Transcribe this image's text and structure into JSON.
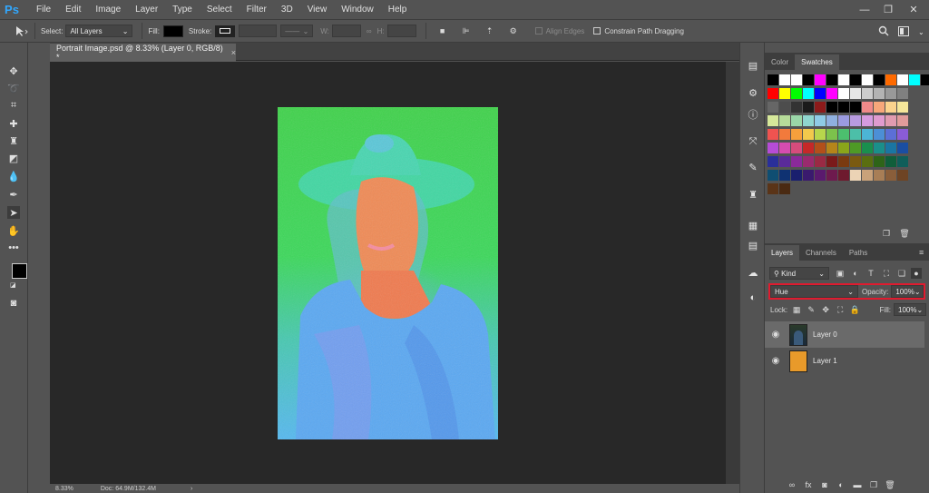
{
  "app": {
    "logo": "Ps"
  },
  "menu": [
    "File",
    "Edit",
    "Image",
    "Layer",
    "Type",
    "Select",
    "Filter",
    "3D",
    "View",
    "Window",
    "Help"
  ],
  "window_controls": {
    "minimize": "—",
    "restore": "❐",
    "close": "✕"
  },
  "options_bar": {
    "select_label": "Select:",
    "select_value": "All Layers",
    "fill_label": "Fill:",
    "stroke_label": "Stroke:",
    "w_label": "W:",
    "h_label": "H:",
    "align_edges": "Align Edges",
    "constrain": "Constrain Path Dragging"
  },
  "document": {
    "tab_title": "Portrait Image.psd @ 8.33% (Layer 0, RGB/8) *",
    "zoom": "8.33%",
    "doc_size": "Doc: 64.9M/132.4M"
  },
  "color_panel": {
    "tabs": [
      "Color",
      "Swatches"
    ],
    "active_tab": "Swatches"
  },
  "layers_panel": {
    "tabs": [
      "Layers",
      "Channels",
      "Paths"
    ],
    "kind_label": "Kind",
    "blend_mode": "Hue",
    "opacity_label": "Opacity:",
    "opacity_value": "100%",
    "lock_label": "Lock:",
    "fill_label": "Fill:",
    "fill_value": "100%",
    "layers": [
      {
        "name": "Layer 0"
      },
      {
        "name": "Layer 1"
      }
    ]
  },
  "swatches": [
    [
      "#000000",
      "#ffffff",
      "#ffffff",
      "#000000",
      "#ff00ff",
      "#000000",
      "#ffffff",
      "#000000",
      "#ffffff",
      "#000000",
      "#ff6a00",
      "#ffffff",
      "#00ffff",
      "#000000"
    ],
    [
      "#ff0000",
      "#ffff00",
      "#00ff00",
      "#00ffff",
      "#0000ff",
      "#ff00ff",
      "#ffffff",
      "#e6e6e6",
      "#cccccc",
      "#b3b3b3",
      "#999999",
      "#808080"
    ],
    [
      "#666666",
      "#4d4d4d",
      "#333333",
      "#1a1a1a",
      "#8c1a1a",
      "#000000",
      "#000000",
      "#000000",
      "#f08a8a",
      "#f7a77a",
      "#fbd38d",
      "#f5e69a"
    ],
    [
      "#d6e89a",
      "#b7dc9a",
      "#9ad6a8",
      "#8fd6cf",
      "#8fcbe6",
      "#8fb0e0",
      "#9b9be0",
      "#b89be0",
      "#d69be0",
      "#e09bcf",
      "#e09bb0",
      "#e09b9b"
    ],
    [
      "#ef5350",
      "#f27a3c",
      "#f6a03c",
      "#f2c94c",
      "#b7d64c",
      "#7cc24c",
      "#4cbf6e",
      "#4cbfa8",
      "#4cb5d6",
      "#4c8fd6",
      "#5c6fd6",
      "#8a5cd6"
    ],
    [
      "#b64cd6",
      "#d64cb0",
      "#d64c7c",
      "#c62828",
      "#b34f1a",
      "#b5851a",
      "#8aa61a",
      "#4e9a26",
      "#1a8f4e",
      "#1a8f8a",
      "#1a76a3",
      "#1a4ea3"
    ],
    [
      "#2a2f9a",
      "#5a2a9a",
      "#8a2a9a",
      "#9a2a6e",
      "#9a2a44",
      "#7a1a1a",
      "#7a3a10",
      "#7a5a10",
      "#5a6e10",
      "#2e6418",
      "#105e3a",
      "#0f5e5a"
    ],
    [
      "#0f4e72",
      "#0f3272",
      "#1a1f6e",
      "#3a1a6e",
      "#5a1a6e",
      "#6e1a4e",
      "#6e1a2e",
      "#ecd3b5",
      "#c9a27a",
      "#a87e56",
      "#8a5e3a",
      "#6e4424"
    ],
    [
      "#5a3418",
      "#4a2a12"
    ]
  ]
}
